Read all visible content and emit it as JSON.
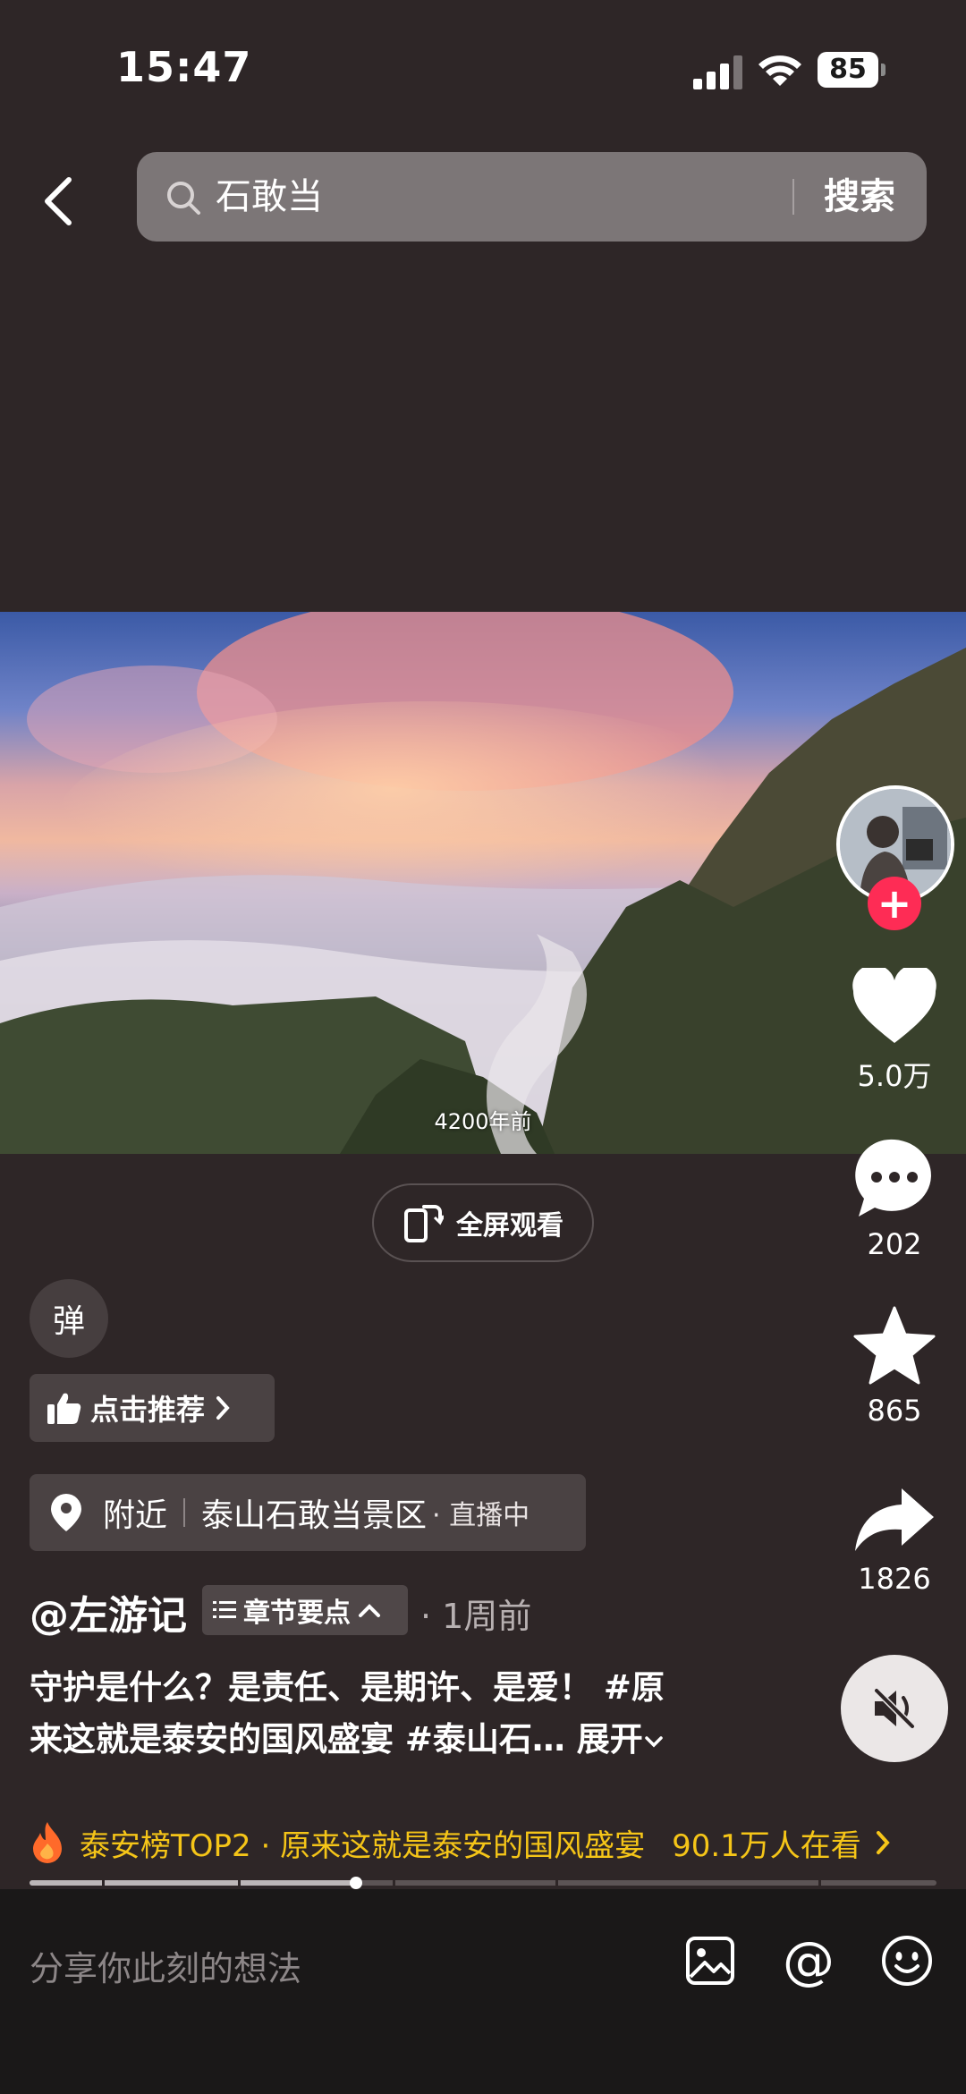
{
  "status_bar": {
    "time": "15:47",
    "battery": "85"
  },
  "search": {
    "query": "石敢当",
    "button_label": "搜索"
  },
  "video": {
    "caption": "4200年前"
  },
  "fullscreen": {
    "label": "全屏观看"
  },
  "danmaku": {
    "label": "弹"
  },
  "recommend": {
    "label": "点击推荐"
  },
  "location": {
    "nearby": "附近",
    "name": "泰山石敢当景区",
    "live": "· 直播中"
  },
  "author": {
    "name": "@左游记",
    "chapter_label": "章节要点",
    "post_time": "· 1周前"
  },
  "description": {
    "line1": "守护是什么？是责任、是期许、是爱！ #原",
    "line2_text": "来这就是泰安的国风盛宴 #泰山石… ",
    "expand": "展开"
  },
  "hot_ranking": {
    "text": "泰安榜TOP2 · 原来这就是泰安的国风盛宴",
    "viewers": "90.1万人在看"
  },
  "progress": {
    "fraction": 0.36,
    "chapters": [
      0.08,
      0.23,
      0.4,
      0.58,
      0.87
    ]
  },
  "actions": {
    "likes": "5.0万",
    "comments": "202",
    "favorites": "865",
    "shares": "1826"
  },
  "comment_bar": {
    "placeholder": "分享你此刻的想法"
  },
  "colors": {
    "background": "#2e2627",
    "accent": "#fe2c55",
    "hot": "#f5c518"
  }
}
